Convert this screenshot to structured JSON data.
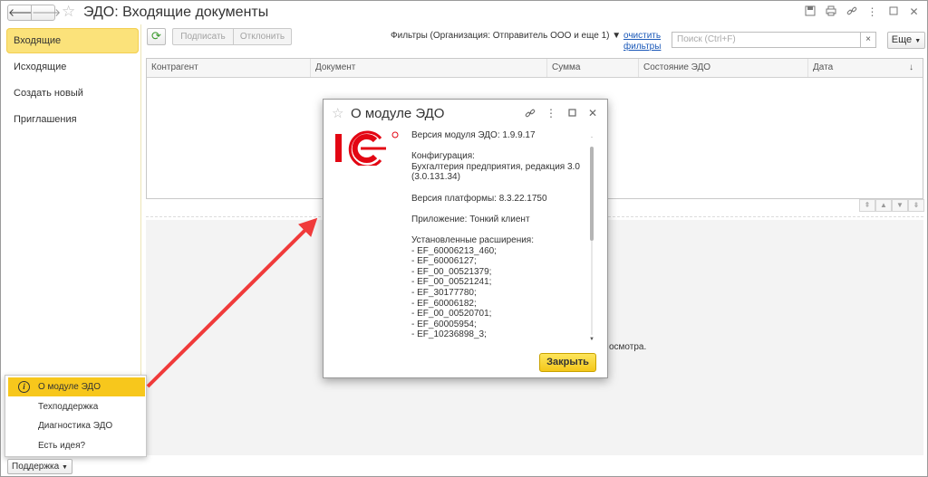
{
  "window": {
    "title": "ЭДО: Входящие документы",
    "nav_back": "🡐",
    "nav_forward": "🡒",
    "icons": [
      "save-icon",
      "print-icon",
      "link-icon",
      "menu-icon",
      "maximize-icon",
      "close-icon"
    ]
  },
  "sidebar": {
    "items": [
      {
        "label": "Входящие",
        "active": true
      },
      {
        "label": "Исходящие",
        "active": false
      },
      {
        "label": "Создать новый",
        "active": false
      },
      {
        "label": "Приглашения",
        "active": false
      }
    ]
  },
  "toolbar": {
    "sign_label": "Подписать",
    "reject_label": "Отклонить",
    "filters_text": "Фильтры (Организация: Отправитель ООО и еще 1)",
    "clear_filters_line1": "очистить",
    "clear_filters_line2": "фильтры",
    "search_placeholder": "Поиск (Ctrl+F)",
    "more_label": "Еще"
  },
  "table": {
    "columns": [
      "Контрагент",
      "Документ",
      "Сумма",
      "Состояние ЭДО",
      "Дата"
    ],
    "sort_indicator": "↓"
  },
  "background_text": "осмотра.",
  "support_menu": {
    "button_label": "Поддержка",
    "items": [
      {
        "label": "О модуле ЭДО",
        "active": true,
        "icon": "info-icon"
      },
      {
        "label": "Техподдержка",
        "active": false
      },
      {
        "label": "Диагностика ЭДО",
        "active": false
      },
      {
        "label": "Есть идея?",
        "active": false
      }
    ]
  },
  "dialog": {
    "title": "О модуле ЭДО",
    "close_button": "Закрыть",
    "info_lines": [
      "Версия модуля ЭДО: 1.9.9.17",
      "",
      "Конфигурация:",
      "Бухгалтерия предприятия, редакция 3.0",
      "(3.0.131.34)",
      "",
      "Версия платформы: 8.3.22.1750",
      "",
      "Приложение: Тонкий клиент",
      "",
      "Установленные расширения:",
      "- EF_60006213_460;",
      "- EF_60006127;",
      "- EF_00_00521379;",
      "- EF_00_00521241;",
      "- EF_30177780;",
      "- EF_60006182;",
      "- EF_00_00520701;",
      "- EF_60005954;",
      "- EF_10236898_3;"
    ]
  },
  "colors": {
    "accent_yellow": "#fbe27a",
    "menu_active": "#f7c71c",
    "arrow_red": "#f03a3a",
    "logo_red": "#e30613"
  }
}
